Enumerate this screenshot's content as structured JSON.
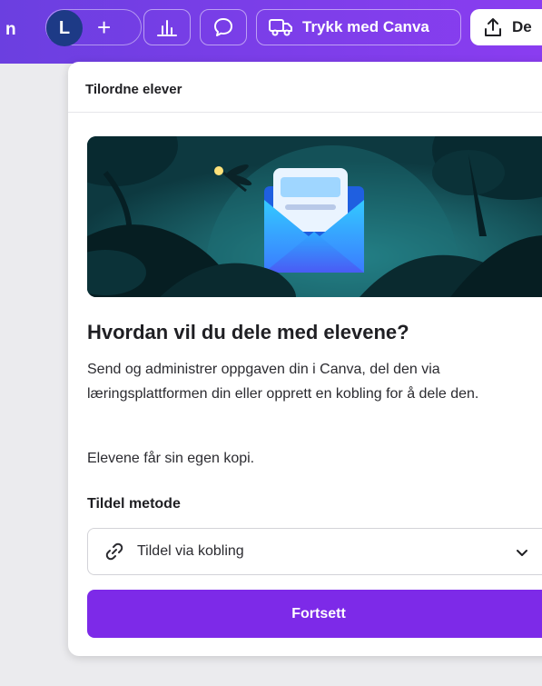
{
  "topbar": {
    "edge_char": "n",
    "avatar_initial": "L",
    "plus_label": "+",
    "print_label": "Trykk med Canva",
    "share_label": "De",
    "icons": [
      "analytics-icon",
      "comment-icon",
      "truck-icon",
      "share-upload-icon"
    ]
  },
  "dialog": {
    "header_title": "Tilordne elever",
    "heading": "Hvordan vil du dele med elevene?",
    "description": "Send og administrer oppgaven din i Canva, del den via læringsplattformen din eller opprett en kobling for å dele den.",
    "note": "Elevene får sin egen kopi.",
    "method_label": "Tildel metode",
    "method_value": "Tildel via kobling",
    "continue_label": "Fortsett"
  },
  "colors": {
    "topbar": "#7a3ee8",
    "primary_button": "#7d2ae8",
    "avatar": "#1d3a86"
  }
}
